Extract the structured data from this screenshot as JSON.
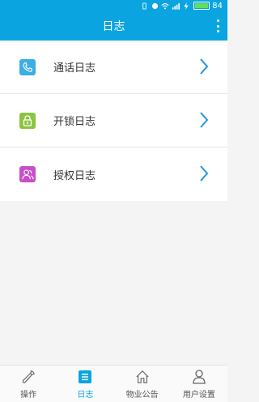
{
  "status": {
    "battery": "84"
  },
  "header": {
    "title": "日志"
  },
  "list": [
    {
      "label": "通话日志",
      "icon": "phone-icon",
      "color": "#3aaee5"
    },
    {
      "label": "开锁日志",
      "icon": "unlock-icon",
      "color": "#8cc43e"
    },
    {
      "label": "授权日志",
      "icon": "users-icon",
      "color": "#c74fc9"
    }
  ],
  "tabs": [
    {
      "label": "操作",
      "icon": "wrench-icon",
      "active": false
    },
    {
      "label": "日志",
      "icon": "list-icon",
      "active": true
    },
    {
      "label": "物业公告",
      "icon": "home-icon",
      "active": false
    },
    {
      "label": "用户设置",
      "icon": "user-icon",
      "active": false
    }
  ],
  "colors": {
    "primary": "#0aa5e1",
    "chevron": "#1f9ad6"
  }
}
